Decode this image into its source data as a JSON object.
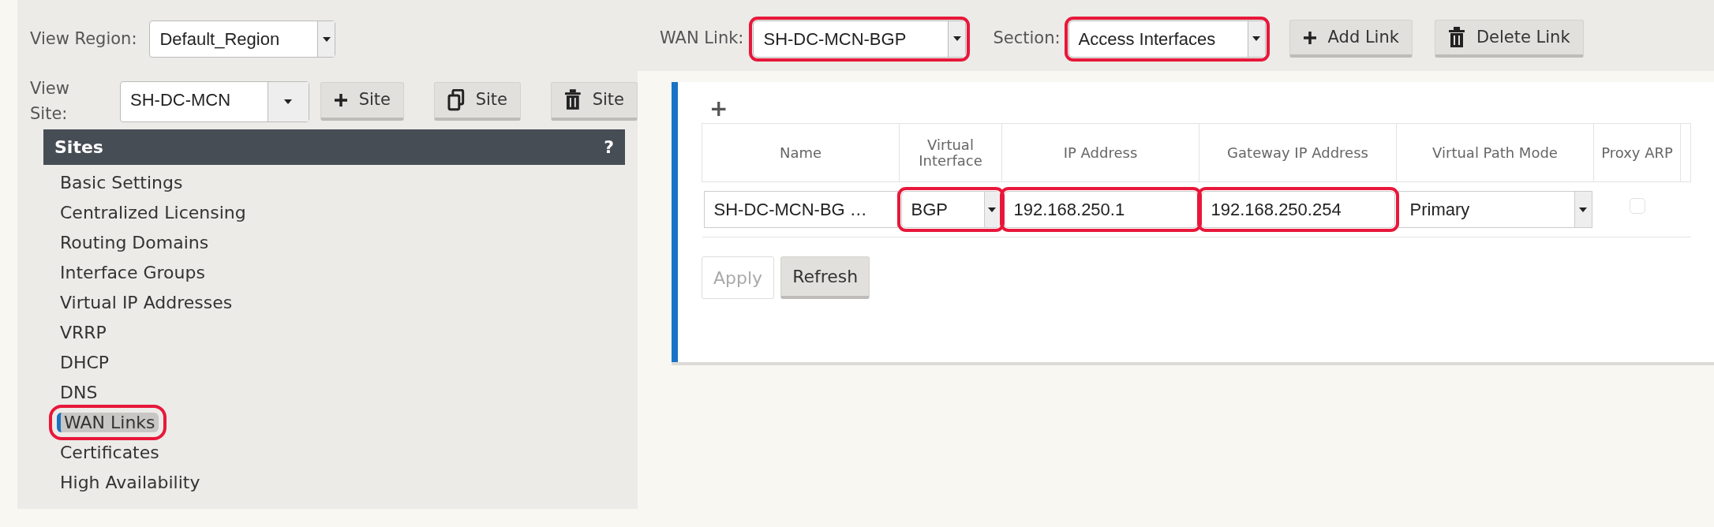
{
  "left_panel": {
    "view_region": {
      "label": "View Region:",
      "value": "Default_Region"
    },
    "view_site": {
      "label": "View Site:",
      "value": "SH-DC-MCN"
    },
    "site_buttons": [
      {
        "kind": "add",
        "label": "Site"
      },
      {
        "kind": "copy",
        "label": "Site"
      },
      {
        "kind": "delete",
        "label": "Site"
      }
    ],
    "sites_header": {
      "title": "Sites",
      "help": "?"
    },
    "sites_menu": [
      {
        "label": "Basic Settings",
        "selected": false,
        "highlighted": false
      },
      {
        "label": "Centralized Licensing",
        "selected": false,
        "highlighted": false
      },
      {
        "label": "Routing Domains",
        "selected": false,
        "highlighted": false
      },
      {
        "label": "Interface Groups",
        "selected": false,
        "highlighted": false
      },
      {
        "label": "Virtual IP Addresses",
        "selected": false,
        "highlighted": false
      },
      {
        "label": "VRRP",
        "selected": false,
        "highlighted": false
      },
      {
        "label": "DHCP",
        "selected": false,
        "highlighted": false
      },
      {
        "label": "DNS",
        "selected": false,
        "highlighted": false
      },
      {
        "label": "WAN Links",
        "selected": true,
        "highlighted": true
      },
      {
        "label": "Certificates",
        "selected": false,
        "highlighted": false
      },
      {
        "label": "High Availability",
        "selected": false,
        "highlighted": false
      }
    ]
  },
  "toolbar": {
    "wan_link": {
      "label": "WAN Link:",
      "value": "SH-DC-MCN-BGP",
      "highlighted": true
    },
    "section": {
      "label": "Section:",
      "value": "Access Interfaces",
      "highlighted": true
    },
    "buttons": [
      {
        "kind": "add",
        "label": "Add Link"
      },
      {
        "kind": "delete",
        "label": "Delete Link"
      }
    ]
  },
  "table": {
    "add_row": "+",
    "columns": [
      "Name",
      "Virtual Interface",
      "IP Address",
      "Gateway IP Address",
      "Virtual Path Mode",
      "Proxy ARP"
    ],
    "rows": [
      {
        "name": "SH-DC-MCN-BG …",
        "virtual_interface": {
          "value": "BGP",
          "highlighted": true
        },
        "ip_address": {
          "value": "192.168.250.1",
          "highlighted": true
        },
        "gateway_ip": {
          "value": "192.168.250.254",
          "highlighted": true
        },
        "virtual_path_mode": "Primary",
        "proxy_arp": false
      }
    ],
    "buttons": [
      {
        "label": "Apply",
        "disabled": true
      },
      {
        "label": "Refresh",
        "disabled": false
      }
    ]
  }
}
